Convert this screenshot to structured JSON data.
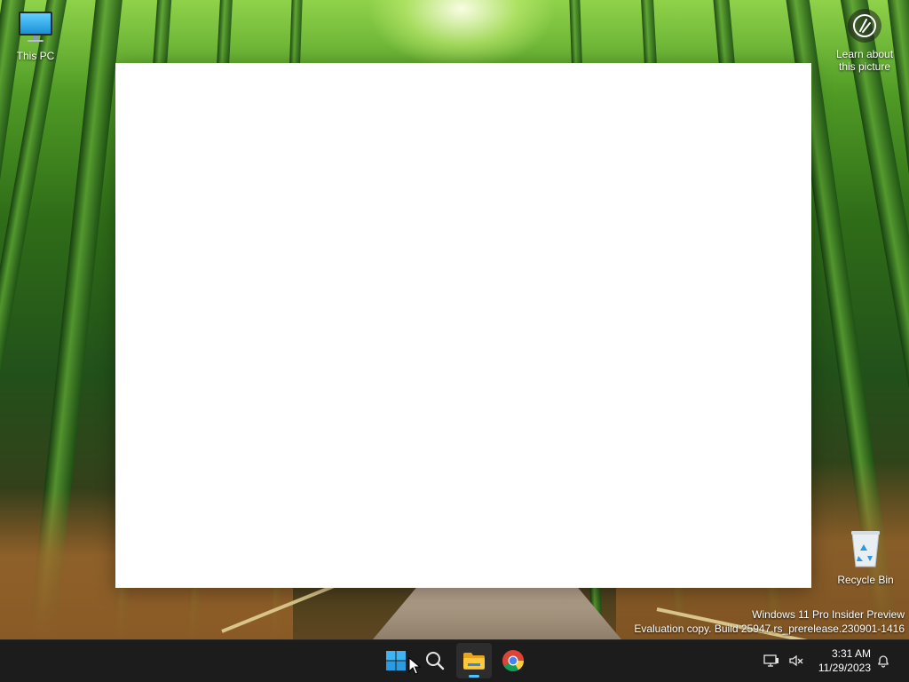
{
  "desktop": {
    "icons": [
      {
        "label": "This PC",
        "icon": "computer-monitor-icon"
      },
      {
        "label": "Recycle Bin",
        "icon": "recycle-bin-icon"
      }
    ],
    "learn_picture": {
      "line1": "Learn about",
      "line2": "this picture",
      "icon": "camera-info-icon"
    },
    "watermark": {
      "line1": "Windows 11 Pro Insider Preview",
      "line2": "Evaluation copy. Build 25947.rs_prerelease.230901-1416"
    },
    "window": {
      "state": "blank"
    }
  },
  "taskbar": {
    "apps": [
      {
        "name": "Start",
        "icon": "windows-logo-icon"
      },
      {
        "name": "Search",
        "icon": "search-icon"
      },
      {
        "name": "File Explorer",
        "icon": "folder-icon",
        "active": true
      },
      {
        "name": "Google Chrome",
        "icon": "chrome-icon"
      }
    ],
    "tray": {
      "network_icon": "network-icon",
      "volume_icon": "volume-muted-icon",
      "notification_icon": "bell-icon"
    },
    "clock": {
      "time": "3:31 AM",
      "date": "11/29/2023"
    }
  },
  "colors": {
    "taskbar_bg": "#1c1c1c",
    "accent": "#4cc2ff",
    "window_bg": "#ffffff"
  }
}
